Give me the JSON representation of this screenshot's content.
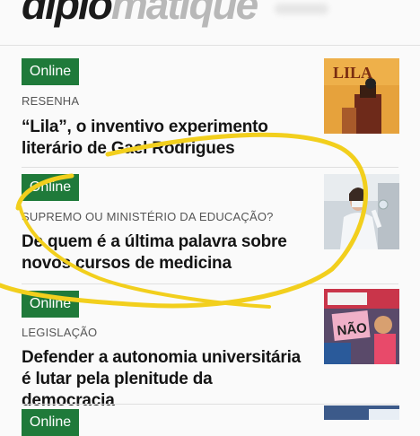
{
  "masthead": {
    "logo_dark": "diplo",
    "logo_light": "matique"
  },
  "articles": [
    {
      "badge": "Online",
      "kicker": "RESENHA",
      "title": "“Lila”, o inventivo experimento literário de Gael Rodrigues",
      "thumb_text": "LILA"
    },
    {
      "badge": "Online",
      "kicker": "SUPREMO OU MINISTÉRIO DA EDUCAÇÃO?",
      "title": "De quem é a última palavra sobre novos cursos de medicina"
    },
    {
      "badge": "Online",
      "kicker": "LEGISLAÇÃO",
      "title": "Defender a autonomia universitária é lutar pela plenitude da democracia",
      "thumb_text": "NÃO"
    },
    {
      "badge": "Online"
    }
  ],
  "colors": {
    "badge": "#1f7a3a",
    "scribble": "#f2cf1d"
  }
}
